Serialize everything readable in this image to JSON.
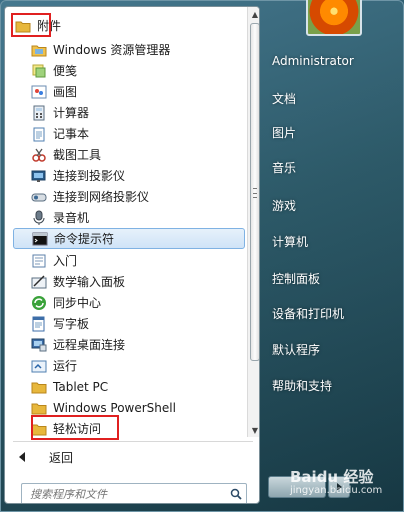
{
  "start_menu": {
    "folder": {
      "label": "附件",
      "icon": "folder-icon"
    },
    "items": [
      {
        "label": "Windows 资源管理器",
        "icon": "explorer-icon"
      },
      {
        "label": "便笺",
        "icon": "sticky-notes-icon"
      },
      {
        "label": "画图",
        "icon": "paint-icon"
      },
      {
        "label": "计算器",
        "icon": "calculator-icon"
      },
      {
        "label": "记事本",
        "icon": "notepad-icon"
      },
      {
        "label": "截图工具",
        "icon": "snipping-tool-icon"
      },
      {
        "label": "连接到投影仪",
        "icon": "projector-icon"
      },
      {
        "label": "连接到网络投影仪",
        "icon": "network-projector-icon"
      },
      {
        "label": "录音机",
        "icon": "sound-recorder-icon"
      },
      {
        "label": "命令提示符",
        "icon": "command-prompt-icon",
        "selected": true
      },
      {
        "label": "入门",
        "icon": "getting-started-icon"
      },
      {
        "label": "数学输入面板",
        "icon": "math-input-icon"
      },
      {
        "label": "同步中心",
        "icon": "sync-center-icon"
      },
      {
        "label": "写字板",
        "icon": "wordpad-icon"
      },
      {
        "label": "远程桌面连接",
        "icon": "remote-desktop-icon"
      },
      {
        "label": "运行",
        "icon": "run-icon"
      },
      {
        "label": "Tablet PC",
        "icon": "folder-icon"
      },
      {
        "label": "Windows PowerShell",
        "icon": "folder-icon"
      },
      {
        "label": "轻松访问",
        "icon": "folder-icon"
      }
    ],
    "back_label": "返回",
    "search_placeholder": "搜索程序和文件"
  },
  "right_panel": {
    "user": "Administrator",
    "items": [
      "文档",
      "图片",
      "音乐",
      "游戏",
      "计算机",
      "控制面板",
      "设备和打印机",
      "默认程序",
      "帮助和支持"
    ]
  },
  "watermark": {
    "title": "Baidu 经验",
    "url": "jingyan.baidu.com"
  },
  "colors": {
    "highlight": "#e02020",
    "selection": "#cfe3f7"
  }
}
